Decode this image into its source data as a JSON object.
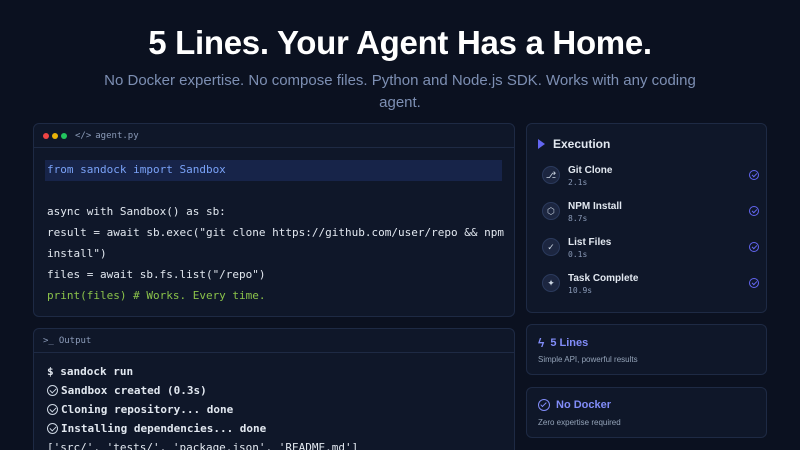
{
  "hero": {
    "title": "5 Lines. Your Agent Has a Home.",
    "subtitle": "No Docker expertise. No compose files. Python and Node.js SDK. Works with any coding agent."
  },
  "code_panel": {
    "filename": "agent.py",
    "file_icon": "code-icon",
    "lines": [
      "from sandock import Sandbox",
      "",
      "async with Sandbox() as sb:",
      "result = await sb.exec(\"git clone https://github.com/user/repo && npm",
      "install\")",
      "files = await sb.fs.list(\"/repo\")",
      "print(files) # Works. Every time."
    ]
  },
  "output_panel": {
    "title": "Output",
    "title_icon": "terminal-icon",
    "lines": [
      "$ sandock run",
      "Sandbox created (0.3s)",
      "Cloning repository... done",
      "Installing dependencies... done",
      "['src/', 'tests/', 'package.json', 'README.md']"
    ]
  },
  "execution": {
    "title": "Execution",
    "steps": [
      {
        "label": "Git Clone",
        "time": "2.1s",
        "icon": "git-branch-icon"
      },
      {
        "label": "NPM Install",
        "time": "8.7s",
        "icon": "package-icon"
      },
      {
        "label": "List Files",
        "time": "0.1s",
        "icon": "check-circle-icon"
      },
      {
        "label": "Task Complete",
        "time": "10.9s",
        "icon": "sparkle-icon"
      }
    ]
  },
  "features": [
    {
      "title": "5 Lines",
      "desc": "Simple API, powerful results",
      "icon": "lightning-icon"
    },
    {
      "title": "No Docker",
      "desc": "Zero expertise required",
      "icon": "check-circle-icon"
    }
  ],
  "colors": {
    "background": "#0b1120",
    "panel": "#0f1729",
    "accent": "#818cf8",
    "keyword": "#7aa2f7",
    "comment_green": "#8bc34a"
  }
}
